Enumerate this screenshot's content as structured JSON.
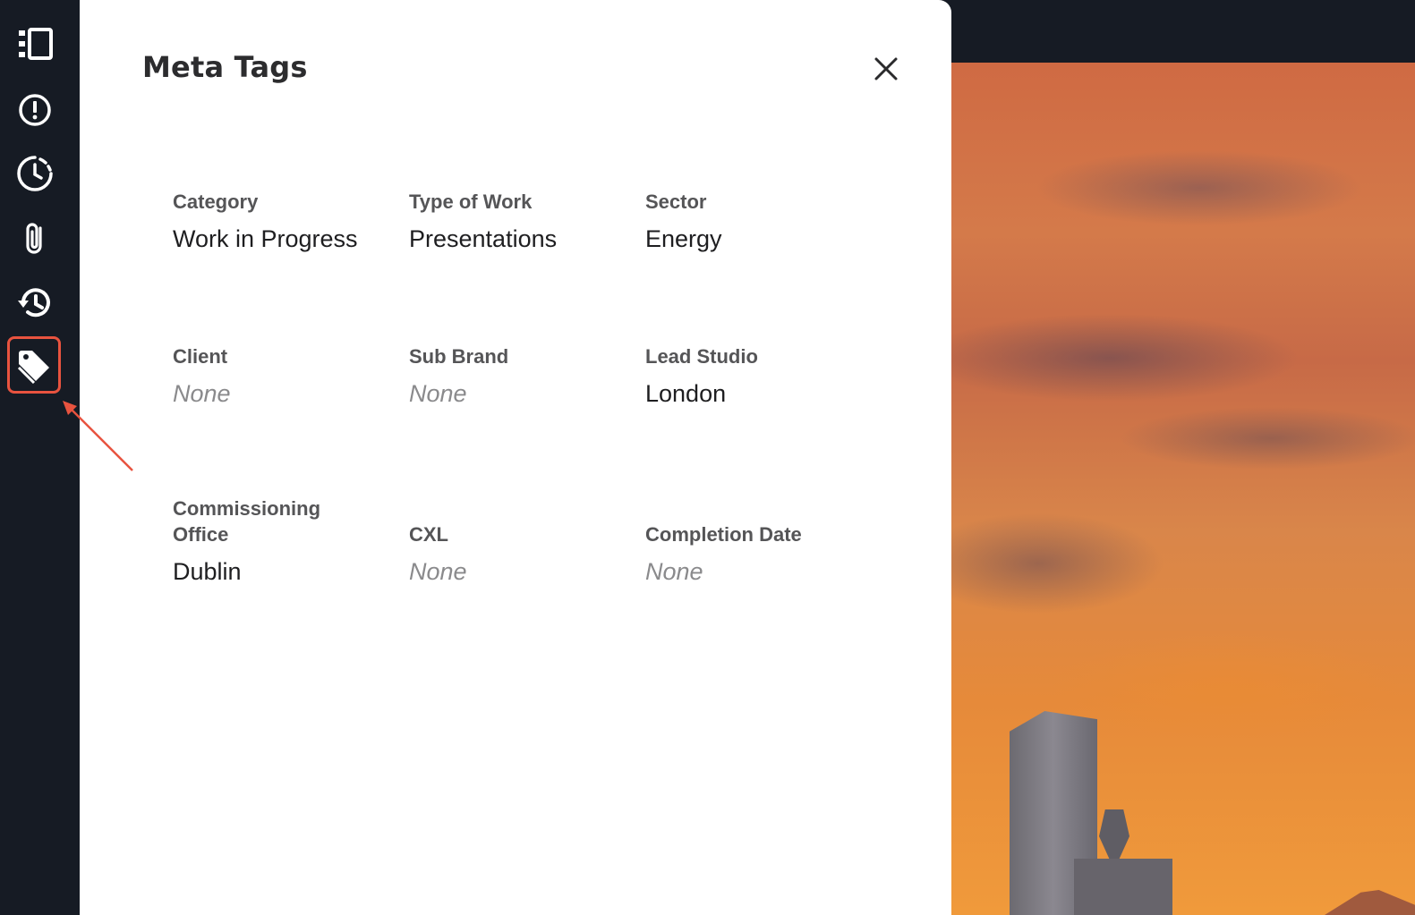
{
  "panel": {
    "title": "Meta Tags",
    "close_label": "×"
  },
  "rail": {
    "items": [
      {
        "icon": "sidebar-toggle-icon",
        "active": false
      },
      {
        "icon": "alert-circle-icon",
        "active": false
      },
      {
        "icon": "clock-icon",
        "active": false
      },
      {
        "icon": "paperclip-icon",
        "active": false
      },
      {
        "icon": "history-icon",
        "active": false
      },
      {
        "icon": "tag-icon",
        "active": true
      }
    ],
    "highlight_color": "#e8533f"
  },
  "fields": [
    {
      "label": "Category",
      "value": "Work in Progress",
      "empty": false
    },
    {
      "label": "Type of Work",
      "value": "Presentations",
      "empty": false
    },
    {
      "label": "Sector",
      "value": "Energy",
      "empty": false
    },
    {
      "label": "Client",
      "value": "None",
      "empty": true
    },
    {
      "label": "Sub Brand",
      "value": "None",
      "empty": true
    },
    {
      "label": "Lead Studio",
      "value": "London",
      "empty": false
    },
    {
      "label": "Commissioning Office",
      "value": "Dublin",
      "empty": false
    },
    {
      "label": "CXL",
      "value": "None",
      "empty": true
    },
    {
      "label": "Completion Date",
      "value": "None",
      "empty": true
    }
  ],
  "colors": {
    "rail_bg": "#161b24",
    "panel_bg": "#ffffff",
    "label": "#555557",
    "value": "#1e1e20",
    "empty_value": "#8a8a8c",
    "annotation": "#e8533f"
  }
}
